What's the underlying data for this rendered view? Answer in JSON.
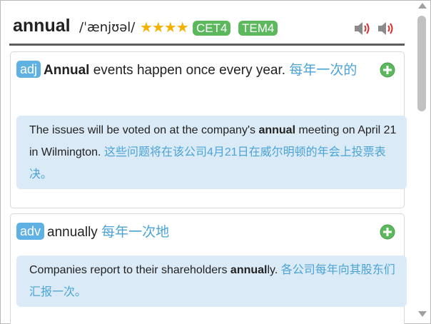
{
  "entry": {
    "word": "annual",
    "phonetic": "/ˈænjʊəl/",
    "stars": "★★★★",
    "tags": [
      "CET4",
      "TEM4"
    ]
  },
  "senses": [
    {
      "pos": "adj",
      "definition_pre": "",
      "definition_bold": "Annual",
      "definition_post": " events happen once every year.",
      "definition_cn": "每年一次的",
      "example": {
        "pre": "The issues will be voted on at the company's ",
        "bold": "annual",
        "post": " meeting on April 21 in Wilmington.",
        "cn": "这些问题将在该公司4月21日在威尔明顿的年会上投票表决。"
      }
    },
    {
      "pos": "adv",
      "definition_pre": "annually",
      "definition_bold": "",
      "definition_post": "",
      "definition_cn": "每年一次地",
      "example": {
        "pre": "Companies report to their shareholders ",
        "bold": "annual",
        "post": "ly.",
        "cn": "各公司每年向其股东们汇报一次。"
      }
    }
  ],
  "icons": {
    "speaker": "speaker-icon",
    "add": "plus-circle-icon"
  },
  "colors": {
    "tag_green": "#5cb85c",
    "pos_blue": "#5fb0e3",
    "chinese_text": "#4ba3d6",
    "example_bg": "#daeaf6",
    "stars": "#f3b200"
  }
}
